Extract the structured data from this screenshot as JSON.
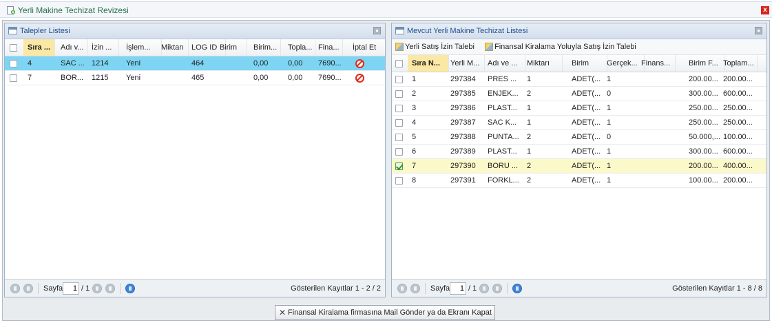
{
  "window": {
    "title": "Yerli Makine Techizat Revizesi",
    "close_label": "x",
    "accent_color": "#28704a"
  },
  "left_panel": {
    "title": "Talepler Listesi",
    "columns": [
      "Sıra ...",
      "Adı v...",
      "İzin ...",
      "İşlem...",
      "Miktarı",
      "LOG ID",
      "Birim",
      "Birim...",
      "Topla...",
      "Fina...",
      "İptal Et"
    ],
    "rows": [
      [
        "4",
        "SAC ...",
        "1214",
        "Yeni",
        "",
        "464",
        "",
        "0,00",
        "0,00",
        "7690..."
      ],
      [
        "7",
        "BOR...",
        "1215",
        "Yeni",
        "",
        "465",
        "",
        "0,00",
        "0,00",
        "7690..."
      ]
    ],
    "selected_row": 0,
    "pager": {
      "page_label": "Sayfa",
      "page_value": "1",
      "page_total": "/ 1",
      "status": "Gösterilen Kayıtlar 1 - 2 / 2"
    }
  },
  "right_panel": {
    "title": "Mevcut Yerli Makine Techizat Listesi",
    "toolbar": {
      "btn1": "Yerli Satış İzin Talebi",
      "btn2": "Finansal Kiralama Yoluyla Satış İzin Talebi"
    },
    "columns": [
      "Sıra N...",
      "Yerli M...",
      "Adı ve ...",
      "Miktarı",
      "Birim",
      "Gerçek...",
      "Finans...",
      "Birim F...",
      "Toplam..."
    ],
    "rows": [
      [
        "1",
        "297384",
        "PRES ...",
        "1",
        "ADET(...",
        "1",
        "",
        "200.00...",
        "200.00..."
      ],
      [
        "2",
        "297385",
        "ENJEK...",
        "2",
        "ADET(...",
        "0",
        "",
        "300.00...",
        "600.00..."
      ],
      [
        "3",
        "297386",
        "PLAST...",
        "1",
        "ADET(...",
        "1",
        "",
        "250.00...",
        "250.00..."
      ],
      [
        "4",
        "297387",
        "SAC K...",
        "1",
        "ADET(...",
        "1",
        "",
        "250.00...",
        "250.00..."
      ],
      [
        "5",
        "297388",
        "PUNTA...",
        "2",
        "ADET(...",
        "0",
        "",
        "50.000,...",
        "100.00..."
      ],
      [
        "6",
        "297389",
        "PLAST...",
        "1",
        "ADET(...",
        "1",
        "",
        "300.00...",
        "600.00..."
      ],
      [
        "7",
        "297390",
        "BORU ...",
        "2",
        "ADET(...",
        "1",
        "",
        "200.00...",
        "400.00..."
      ],
      [
        "8",
        "297391",
        "FORKL...",
        "2",
        "ADET(...",
        "1",
        "",
        "100.00...",
        "200.00..."
      ]
    ],
    "checked_row": 6,
    "pager": {
      "page_label": "Sayfa",
      "page_value": "1",
      "page_total": "/ 1",
      "status": "Gösterilen Kayıtlar 1 - 8 / 8"
    }
  },
  "footer": {
    "button_label": "Finansal Kiralama firmasına Mail Gönder ya da Ekranı Kapat"
  },
  "icons": {
    "title": "add-document-icon",
    "close": "close-icon",
    "cancel": "cancel-icon",
    "pager": [
      "first-page-icon",
      "prev-page-icon",
      "next-page-icon",
      "last-page-icon",
      "refresh-icon"
    ]
  },
  "colors": {
    "selected_row": "#7dd5f3",
    "checked_row": "#fbf9c9",
    "sorted_header": "#fbe8a4",
    "panel_title": "#1e4f8f",
    "cancel": "#e0291a"
  }
}
